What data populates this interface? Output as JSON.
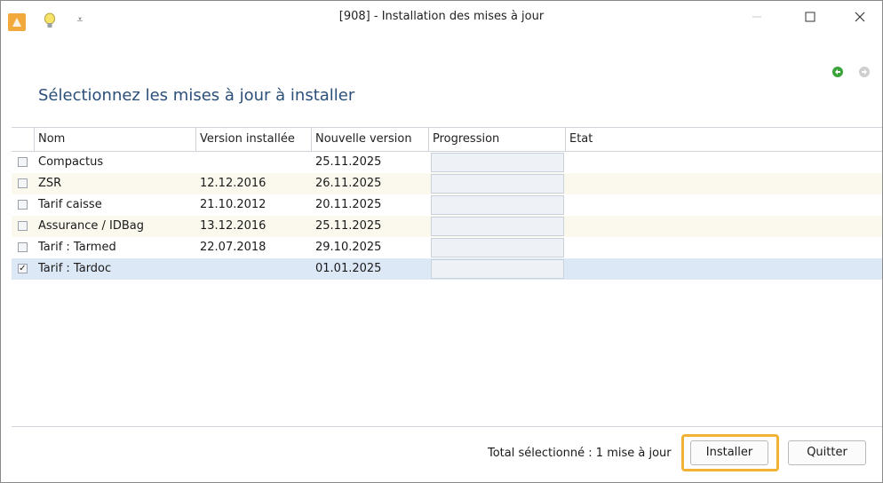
{
  "window": {
    "title": "[908] - Installation des mises à jour",
    "icons": {
      "app": "app-icon",
      "quick_access": "bulb-icon",
      "menu": "quick-access-dropdown-icon"
    },
    "controls": [
      "minimize-icon",
      "maximize-icon",
      "close-icon"
    ]
  },
  "toolbar": {
    "icons": [
      "green-refresh-icon",
      "gray-refresh-icon"
    ]
  },
  "heading": "Sélectionnez les mises à jour à installer",
  "table": {
    "columns": [
      "Nom",
      "Version installée",
      "Nouvelle version",
      "Progression",
      "Etat"
    ],
    "rows": [
      {
        "checked": false,
        "name": "Compactus",
        "installed": "",
        "new": "25.11.2025",
        "progress": 0,
        "state": ""
      },
      {
        "checked": false,
        "name": "ZSR",
        "installed": "12.12.2016",
        "new": "26.11.2025",
        "progress": 0,
        "state": ""
      },
      {
        "checked": false,
        "name": "Tarif caisse",
        "installed": "21.10.2012",
        "new": "20.11.2025",
        "progress": 0,
        "state": ""
      },
      {
        "checked": false,
        "name": "Assurance / IDBag",
        "installed": "13.12.2016",
        "new": "25.11.2025",
        "progress": 0,
        "state": ""
      },
      {
        "checked": false,
        "name": "Tarif : Tarmed",
        "installed": "22.07.2018",
        "new": "29.10.2025",
        "progress": 0,
        "state": ""
      },
      {
        "checked": true,
        "name": "Tarif : Tardoc",
        "installed": "",
        "new": "01.01.2025",
        "progress": 0,
        "state": ""
      }
    ]
  },
  "footer": {
    "total": "Total sélectionné : 1 mise à jour",
    "install": "Installer",
    "quit": "Quitter"
  },
  "colors": {
    "heading": "#2b4f78",
    "highlight": "#f2b233",
    "selected_row": "#dde8f7"
  }
}
